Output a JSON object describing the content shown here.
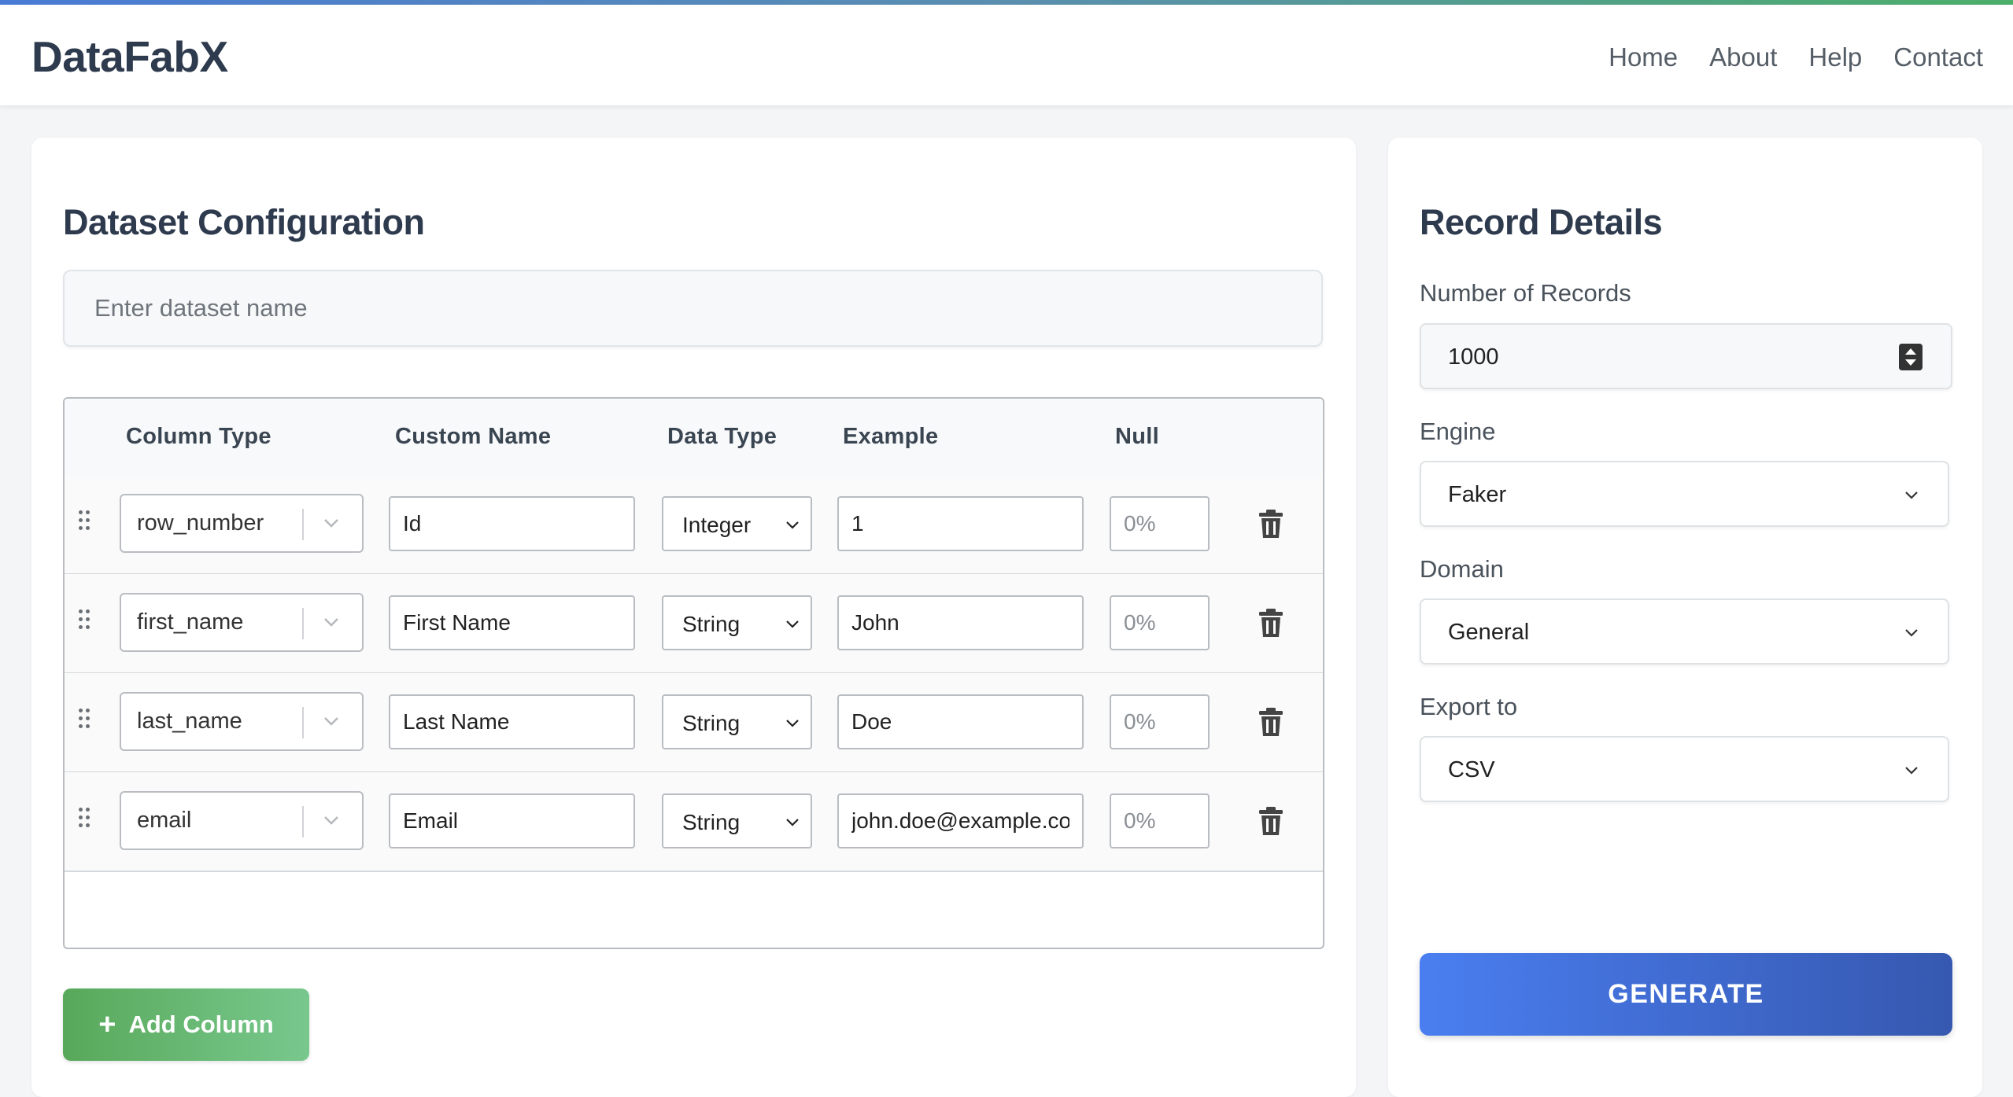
{
  "header": {
    "brand": "DataFabX",
    "nav": [
      "Home",
      "About",
      "Help",
      "Contact"
    ]
  },
  "config": {
    "title": "Dataset Configuration",
    "dataset_name_placeholder": "Enter dataset name",
    "columns_header": [
      "Column Type",
      "Custom Name",
      "Data Type",
      "Example",
      "Null"
    ],
    "rows": [
      {
        "column_type": "row_number",
        "custom_name": "Id",
        "data_type": "Integer",
        "example": "1",
        "null_placeholder": "0%"
      },
      {
        "column_type": "first_name",
        "custom_name": "First Name",
        "data_type": "String",
        "example": "John",
        "null_placeholder": "0%"
      },
      {
        "column_type": "last_name",
        "custom_name": "Last Name",
        "data_type": "String",
        "example": "Doe",
        "null_placeholder": "0%"
      },
      {
        "column_type": "email",
        "custom_name": "Email",
        "data_type": "String",
        "example": "john.doe@example.con",
        "null_placeholder": "0%"
      }
    ],
    "add_column_label": "Add Column",
    "add_column_icon": "plus-icon"
  },
  "details": {
    "title": "Record Details",
    "records_label": "Number of Records",
    "records_value": "1000",
    "engine_label": "Engine",
    "engine_value": "Faker",
    "domain_label": "Domain",
    "domain_value": "General",
    "export_label": "Export to",
    "export_value": "CSV",
    "generate_label": "GENERATE"
  },
  "colors": {
    "brand_text": "#2e3a4d",
    "add_button": "#58a85a",
    "generate_button": "#4a7ef0"
  }
}
